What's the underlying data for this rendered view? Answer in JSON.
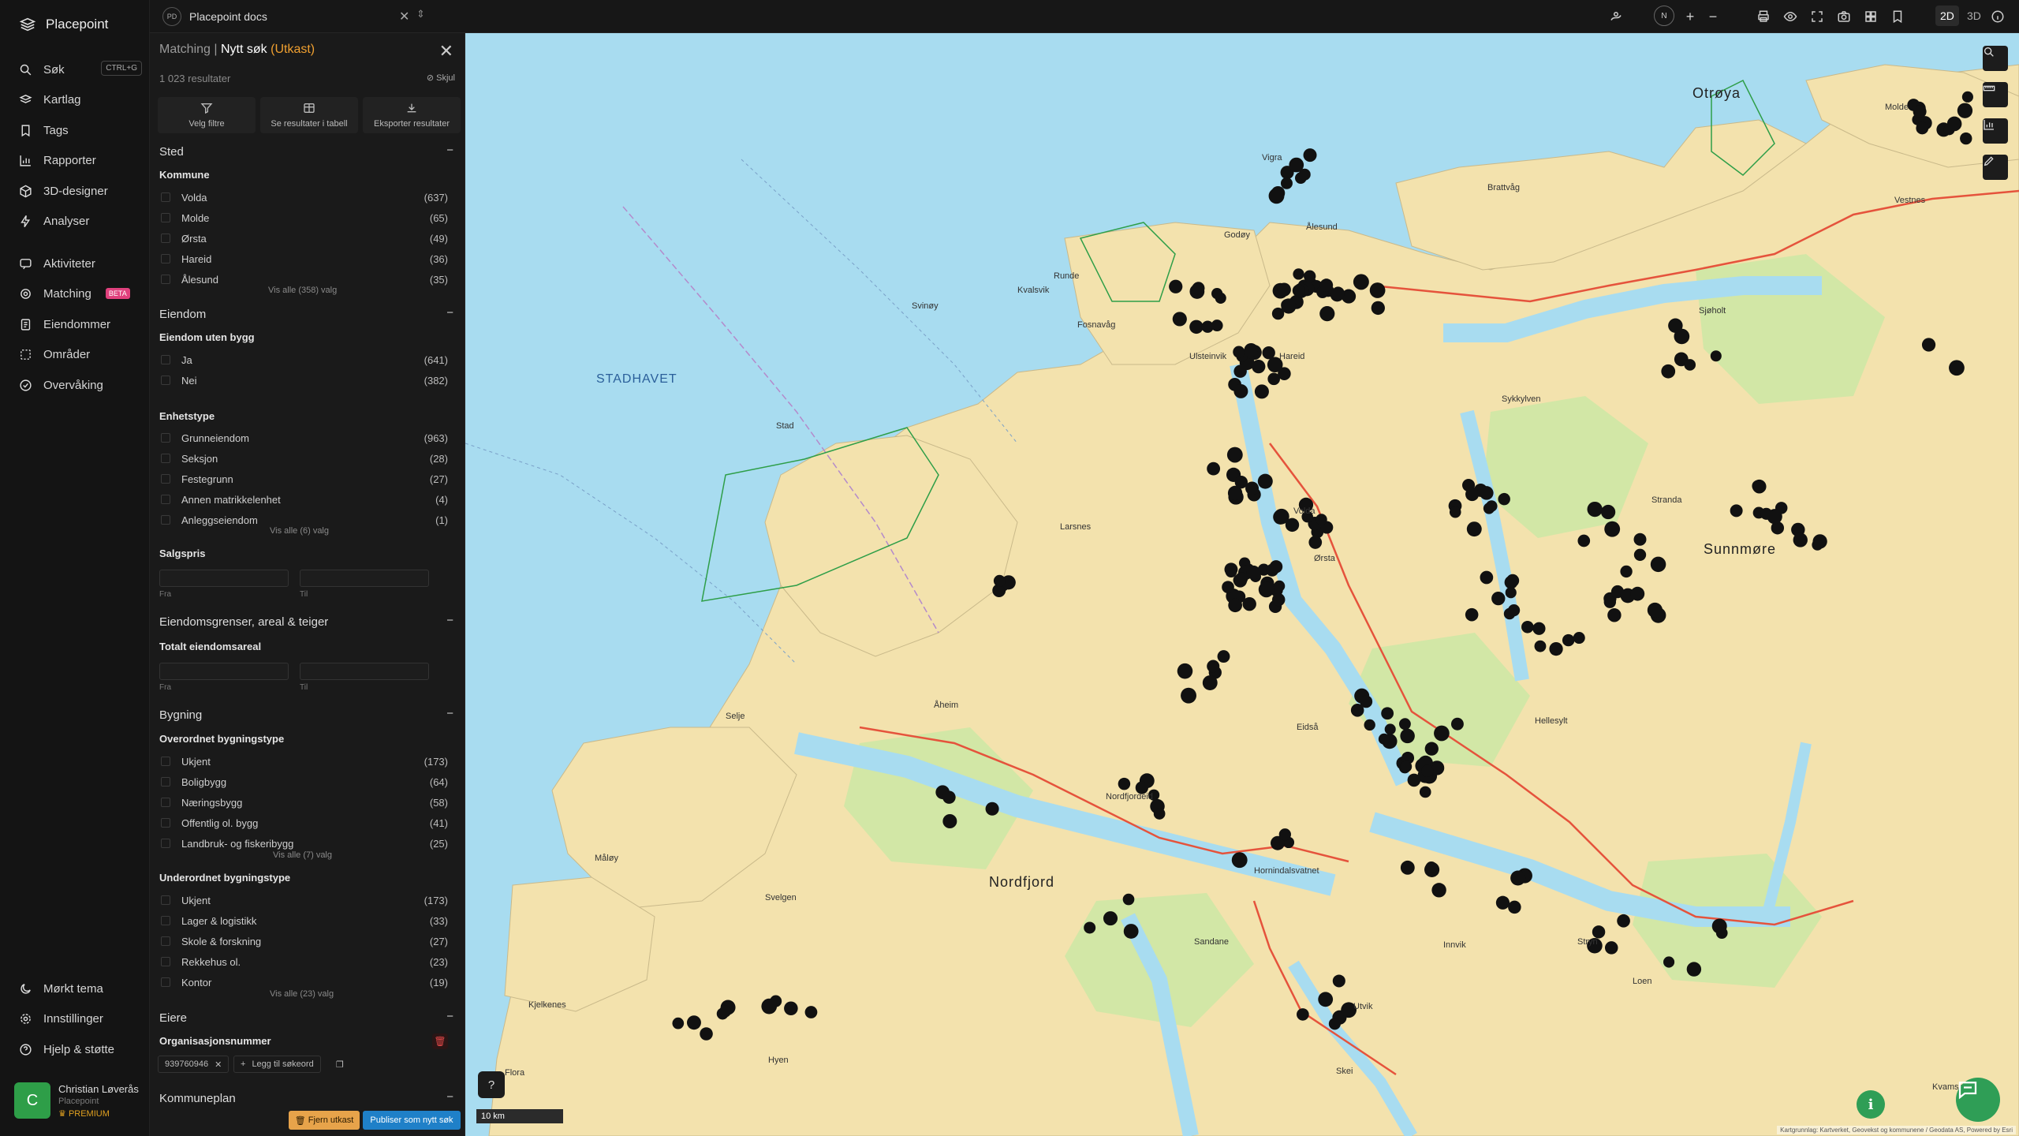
{
  "nav": {
    "brand": "Placepoint",
    "items": [
      {
        "label": "Søk",
        "icon": "search-icon",
        "shortcut": "CTRL+G"
      },
      {
        "label": "Kartlag",
        "icon": "layers-icon"
      },
      {
        "label": "Tags",
        "icon": "bookmark-icon"
      },
      {
        "label": "Rapporter",
        "icon": "bar-chart-icon"
      },
      {
        "label": "3D-designer",
        "icon": "cube-icon"
      },
      {
        "label": "Analyser",
        "icon": "bolt-icon"
      },
      {
        "label": "Aktiviteter",
        "icon": "chat-icon"
      },
      {
        "label": "Matching",
        "icon": "target-icon",
        "badge": "BETA"
      },
      {
        "label": "Eiendommer",
        "icon": "document-icon"
      },
      {
        "label": "Områder",
        "icon": "dashed-square-icon"
      },
      {
        "label": "Overvåking",
        "icon": "check-circle-icon"
      }
    ],
    "bottom": [
      {
        "label": "Mørkt tema",
        "icon": "moon-icon"
      },
      {
        "label": "Innstillinger",
        "icon": "gear-icon"
      },
      {
        "label": "Hjelp & støtte",
        "icon": "question-icon"
      }
    ],
    "user": {
      "initial": "C",
      "name": "Christian Løverås",
      "org": "Placepoint",
      "plan": "PREMIUM"
    }
  },
  "topbar": {
    "doc_badge": "PD",
    "doc_name": "Placepoint docs",
    "north": "N",
    "view_2d": "2D",
    "view_3d": "3D"
  },
  "panel": {
    "crumb_parent": "Matching",
    "crumb_sep": "|",
    "crumb_current": "Nytt søk",
    "crumb_draft": "(Utkast)",
    "result_count": "1 023 resultater",
    "hide_label": "Skjul",
    "actions": [
      "Velg filtre",
      "Se resultater i tabell",
      "Eksporter resultater"
    ],
    "sections": {
      "sted": {
        "title": "Sted",
        "sub": "Kommune",
        "options": [
          [
            "Volda",
            "(637)"
          ],
          [
            "Molde",
            "(65)"
          ],
          [
            "Ørsta",
            "(49)"
          ],
          [
            "Hareid",
            "(36)"
          ],
          [
            "Ålesund",
            "(35)"
          ]
        ],
        "more": "Vis alle (358) valg"
      },
      "eiendom": {
        "title": "Eiendom",
        "sub1": "Eiendom uten bygg",
        "options1": [
          [
            "Ja",
            "(641)"
          ],
          [
            "Nei",
            "(382)"
          ]
        ],
        "sub2": "Enhetstype",
        "options2": [
          [
            "Grunneiendom",
            "(963)"
          ],
          [
            "Seksjon",
            "(28)"
          ],
          [
            "Festegrunn",
            "(27)"
          ],
          [
            "Annen matrikkelenhet",
            "(4)"
          ],
          [
            "Anleggseiendom",
            "(1)"
          ]
        ],
        "more2": "Vis alle (6) valg",
        "sub3": "Salgspris",
        "from": "Fra",
        "to": "Til"
      },
      "grenser": {
        "title": "Eiendomsgrenser, areal & teiger",
        "sub": "Totalt eiendomsareal",
        "from": "Fra",
        "to": "Til"
      },
      "bygning": {
        "title": "Bygning",
        "sub1": "Overordnet bygningstype",
        "options1": [
          [
            "Ukjent",
            "(173)"
          ],
          [
            "Boligbygg",
            "(64)"
          ],
          [
            "Næringsbygg",
            "(58)"
          ],
          [
            "Offentlig ol. bygg",
            "(41)"
          ],
          [
            "Landbruk- og fiskeribygg",
            "(25)"
          ]
        ],
        "more1": "Vis alle (7) valg",
        "sub2": "Underordnet bygningstype",
        "options2": [
          [
            "Ukjent",
            "(173)"
          ],
          [
            "Lager & logistikk",
            "(33)"
          ],
          [
            "Skole & forskning",
            "(27)"
          ],
          [
            "Rekkehus ol.",
            "(23)"
          ],
          [
            "Kontor",
            "(19)"
          ]
        ],
        "more2": "Vis alle (23) valg"
      },
      "eiere": {
        "title": "Eiere",
        "sub": "Organisasjonsnummer",
        "chip": "939760946",
        "add": "Legg til søkeord"
      },
      "kommuneplan": {
        "title": "Kommuneplan"
      }
    },
    "remove_draft": "Fjern utkast",
    "publish": "Publiser som nytt søk"
  },
  "map": {
    "labels": {
      "sea": "STADHAVET",
      "nordfjord": "Nordfjord",
      "sunnmore": "Sunnmøre",
      "otroy": "Otrøya",
      "molde": "Molde",
      "hareid": "Hareid",
      "volda": "Volda",
      "orsta": "Ørsta",
      "stad": "Stad",
      "eidsa": "Eidså",
      "svinoy": "Svinøy",
      "kvalsvik": "Kvalsvik",
      "fosnavag": "Fosnavåg",
      "runde": "Runde",
      "ulsteinvik": "Ulsteinvik",
      "larsnes": "Larsnes",
      "aheim": "Åheim",
      "selje": "Selje",
      "maloy": "Måløy",
      "nordfjordeid": "Nordfjordeid",
      "stryn": "Stryn",
      "loen": "Loen",
      "hornindalsvatnet": "Hornindalsvatnet",
      "vestnes": "Vestnes",
      "sykkylven": "Sykkylven",
      "stranda": "Stranda",
      "hellesylt": "Hellesylt",
      "sjoholt": "Sjøholt",
      "alesund": "Ålesund",
      "brattvag": "Brattvåg",
      "vigra": "Vigra",
      "godoy": "Godøy",
      "sandane": "Sandane",
      "innvik": "Innvik",
      "utvik": "Utvik",
      "skei": "Skei",
      "hyen": "Hyen",
      "kjelkenes": "Kjelkenes",
      "flora": "Flora",
      "svelgen": "Svelgen",
      "kvamsnes": "Kvamsnes"
    },
    "scale": "10 km",
    "help": "?",
    "info": "i",
    "attribution": "Kartgrunnlag: Kartverket, Geovekst og kommunene / Geodata AS, Powered by Esri",
    "colors": {
      "sea": "#a8dcf0",
      "land": "#f3e2ad",
      "forest": "#d2e7a6",
      "road": "#e5533c",
      "dot": "#111111"
    }
  }
}
